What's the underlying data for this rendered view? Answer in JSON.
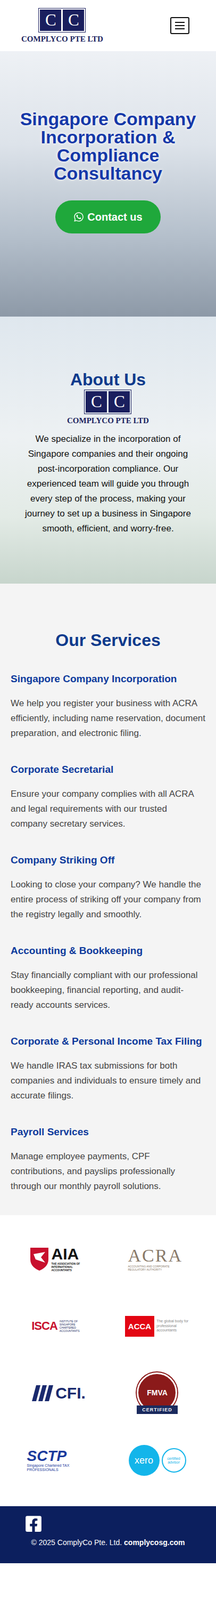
{
  "header": {
    "logo": {
      "letters": [
        "C",
        "C"
      ],
      "name": "COMPLYCO PTE LTD"
    }
  },
  "hero": {
    "title": "Singapore Company Incorporation & Compliance Consultancy",
    "button": "Contact us"
  },
  "about": {
    "title": "About Us",
    "logo": {
      "letters": [
        "C",
        "C"
      ],
      "name": "COMPLYCO PTE LTD"
    },
    "text": "We specialize in the incorporation of Singapore companies and their ongoing post-incorporation compliance. Our experienced team will guide you through every step of the process, making your journey to set up a business in Singapore smooth, efficient, and worry-free."
  },
  "services": {
    "title": "Our Services",
    "items": [
      {
        "title": "Singapore Company Incorporation",
        "text": "We help you register your business with ACRA efficiently, including name reservation, document preparation, and electronic filing."
      },
      {
        "title": "Corporate Secretarial",
        "text": "Ensure your company complies with all ACRA and legal requirements with our trusted company secretary services."
      },
      {
        "title": "Company Striking Off",
        "text": "Looking to close your company? We handle the entire process of striking off your company from the registry legally and smoothly."
      },
      {
        "title": "Accounting & Bookkeeping",
        "text": "Stay financially compliant with our professional bookkeeping, financial reporting, and audit-ready accounts services."
      },
      {
        "title": "Corporate & Personal Income Tax Filing",
        "text": "We handle IRAS tax submissions for both companies and individuals to ensure timely and accurate filings."
      },
      {
        "title": "Payroll Services",
        "text": "Manage employee payments, CPF contributions, and payslips professionally through our monthly payroll solutions."
      }
    ]
  },
  "certifications": [
    {
      "kind": "aia",
      "name": "AIA",
      "caption": "THE ASSOCIATION OF INTERNATIONAL ACCOUNTANTS"
    },
    {
      "kind": "acra",
      "name": "ACRA",
      "caption": "ACCOUNTING AND CORPORATE REGULATORY AUTHORITY"
    },
    {
      "kind": "isca",
      "name": "ISCA",
      "caption": "INSTITUTE OF SINGAPORE CHARTERED ACCOUNTANTS"
    },
    {
      "kind": "acca",
      "name": "ACCA",
      "caption": "The global body for professional accountants"
    },
    {
      "kind": "cfi",
      "name": "CFI."
    },
    {
      "kind": "fmva",
      "name": "FMVA",
      "caption": "CERTIFIED"
    },
    {
      "kind": "sctp",
      "name": "SCTP",
      "caption": "Singapore Chartered TAX PROFESSIONALS"
    },
    {
      "kind": "xero",
      "name": "xero",
      "caption": "certified advisor"
    }
  ],
  "footer": {
    "copyright": "© 2025 ComplyCo Pte. Ltd.",
    "link": "complycosg.com"
  }
}
